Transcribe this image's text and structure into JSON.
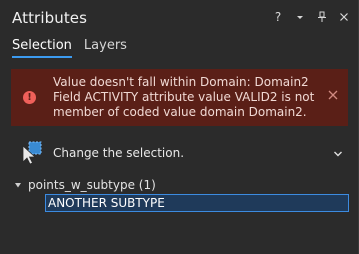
{
  "panel": {
    "title": "Attributes",
    "controls": {
      "help": "?"
    }
  },
  "tabs": [
    {
      "label": "Selection",
      "active": true
    },
    {
      "label": "Layers",
      "active": false
    }
  ],
  "error_banner": {
    "message": "Value doesn't fall within Domain: Domain2\nField ACTIVITY attribute value VALID2 is not member of coded value domain Domain2.",
    "icon": "error-icon",
    "color": "#5a1f17"
  },
  "action": {
    "label": "Change the selection.",
    "icon": "selection-arrow-icon"
  },
  "tree": {
    "layer_label": "points_w_subtype (1)",
    "feature_label": "ANOTHER SUBTYPE"
  },
  "colors": {
    "accent": "#3c9bf0",
    "background": "#2b2b2b",
    "selection": "#1f3a5a"
  }
}
